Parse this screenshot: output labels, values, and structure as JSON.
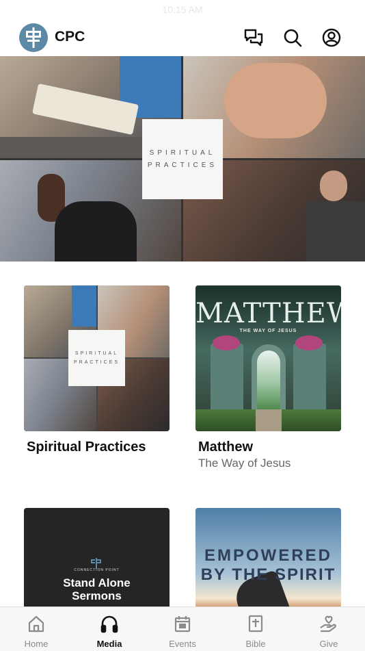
{
  "status_bar": {
    "time": "10:15 AM"
  },
  "header": {
    "brand": "CPC",
    "icons": [
      "chat-icon",
      "search-icon",
      "account-icon"
    ]
  },
  "hero": {
    "line1": "SPIRITUAL",
    "line2": "PRACTICES"
  },
  "series": [
    {
      "title": "Spiritual Practices",
      "subtitle": "",
      "art_line1": "SPIRITUAL",
      "art_line2": "PRACTICES"
    },
    {
      "title": "Matthew",
      "subtitle": "The Way of Jesus",
      "art_title": "MATTHEW",
      "art_subtitle": "THE WAY OF JESUS"
    },
    {
      "art_org": "CONNECTION POINT",
      "art_line1": "Stand Alone",
      "art_line2": "Sermons"
    },
    {
      "art_line1": "EMPOWERED",
      "art_line2": "BY THE SPIRIT"
    }
  ],
  "nav": {
    "items": [
      {
        "label": "Home",
        "icon": "home-icon"
      },
      {
        "label": "Media",
        "icon": "headphones-icon",
        "active": true
      },
      {
        "label": "Events",
        "icon": "calendar-icon"
      },
      {
        "label": "Bible",
        "icon": "bible-icon"
      },
      {
        "label": "Give",
        "icon": "give-icon"
      }
    ]
  },
  "colors": {
    "logo": "#5c8aa6",
    "nav_active": "#111111",
    "nav_inactive": "#8a8a8a"
  }
}
